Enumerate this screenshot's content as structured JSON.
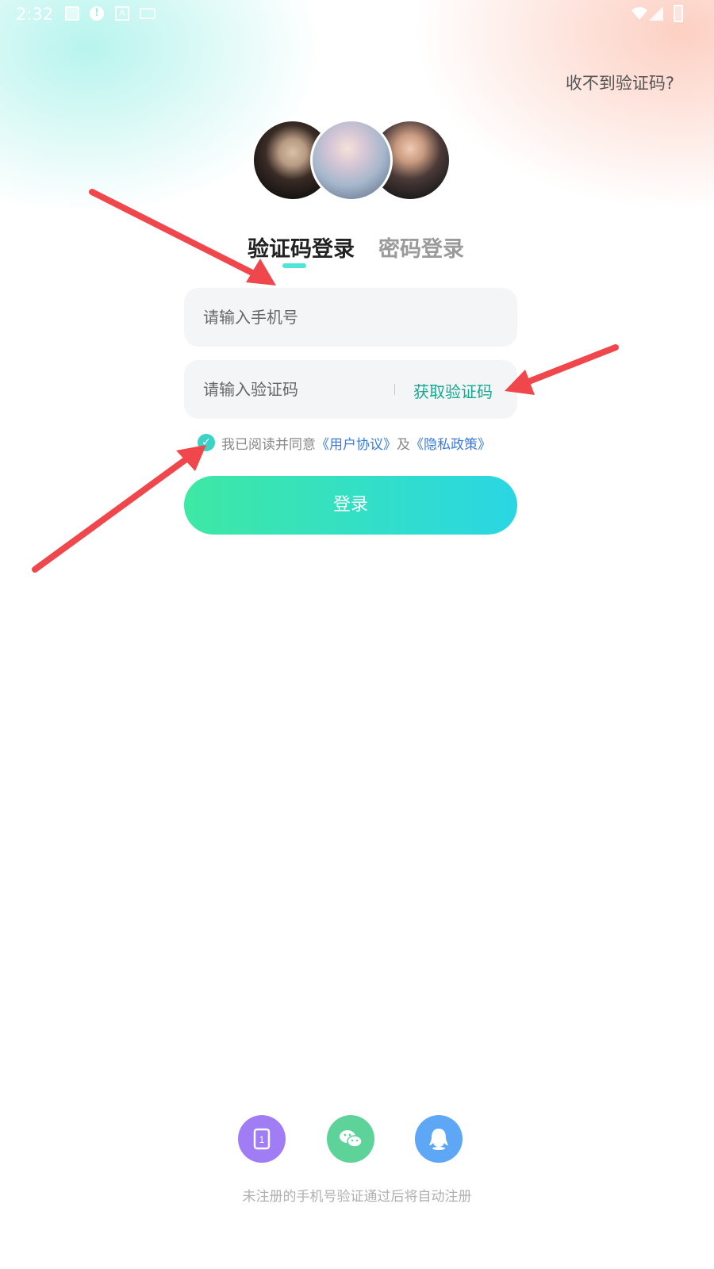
{
  "status_bar": {
    "time": "2:32"
  },
  "header": {
    "help_link": "收不到验证码?"
  },
  "tabs": [
    {
      "label": "验证码登录",
      "active": true
    },
    {
      "label": "密码登录",
      "active": false
    }
  ],
  "form": {
    "phone_placeholder": "请输入手机号",
    "code_placeholder": "请输入验证码",
    "get_code_label": "获取验证码"
  },
  "agreement": {
    "checked": true,
    "prefix": "我已阅读并同意",
    "user_agreement": "《用户协议》",
    "conjunction": "及",
    "privacy_policy": "《隐私政策》"
  },
  "login_button": "登录",
  "social_login": [
    "phone-icon",
    "wechat-icon",
    "qq-icon"
  ],
  "footer": {
    "note": "未注册的手机号验证通过后将自动注册"
  },
  "colors": {
    "accent": "#16a890",
    "link": "#3b7be0",
    "annotation_arrow": "#f0474c",
    "button_gradient_start": "#3ee8a4",
    "button_gradient_end": "#2ad6e3"
  }
}
